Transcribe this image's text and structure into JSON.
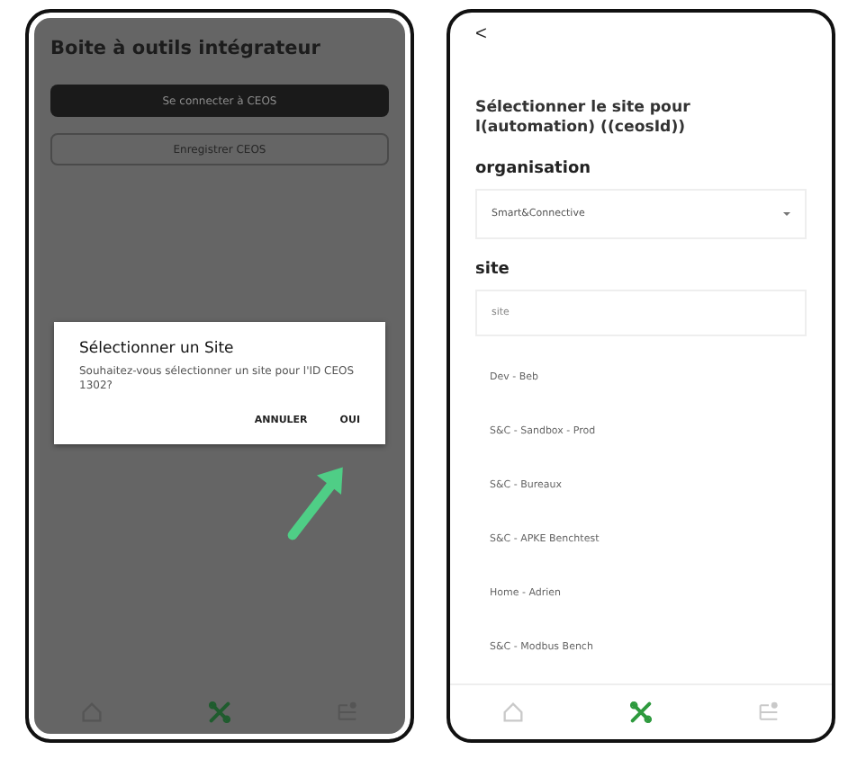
{
  "left_screen": {
    "title": "Boite à outils intégrateur",
    "buttons": [
      {
        "label": "Se connecter à CEOS",
        "kind": "filled"
      },
      {
        "label": "Enregistrer CEOS",
        "kind": "outline"
      }
    ],
    "dialog": {
      "title": "Sélectionner un Site",
      "message": "Souhaitez-vous sélectionner un site pour l'ID CEOS 1302?",
      "actions": [
        "ANNULER",
        "OUI"
      ]
    },
    "nav": [
      {
        "kind": "home",
        "selected": false
      },
      {
        "kind": "tools",
        "selected": true
      },
      {
        "kind": "profile",
        "selected": false
      }
    ]
  },
  "right_screen": {
    "back": "<",
    "heading": "Sélectionner le site pour l(automation) ((ceosId))",
    "organisation_label": "organisation",
    "organisation_value": "Smart&Connective",
    "site_label": "site",
    "site_field": {
      "placeholder": "site"
    },
    "sites": [
      "Dev - Beb",
      "S&C - Sandbox - Prod",
      "S&C - Bureaux",
      "S&C - APKE Benchtest",
      "Home - Adrien",
      "S&C - Modbus Bench"
    ],
    "nav": [
      {
        "kind": "home",
        "selected": false
      },
      {
        "kind": "tools",
        "selected": true
      },
      {
        "kind": "profile",
        "selected": false
      }
    ]
  }
}
